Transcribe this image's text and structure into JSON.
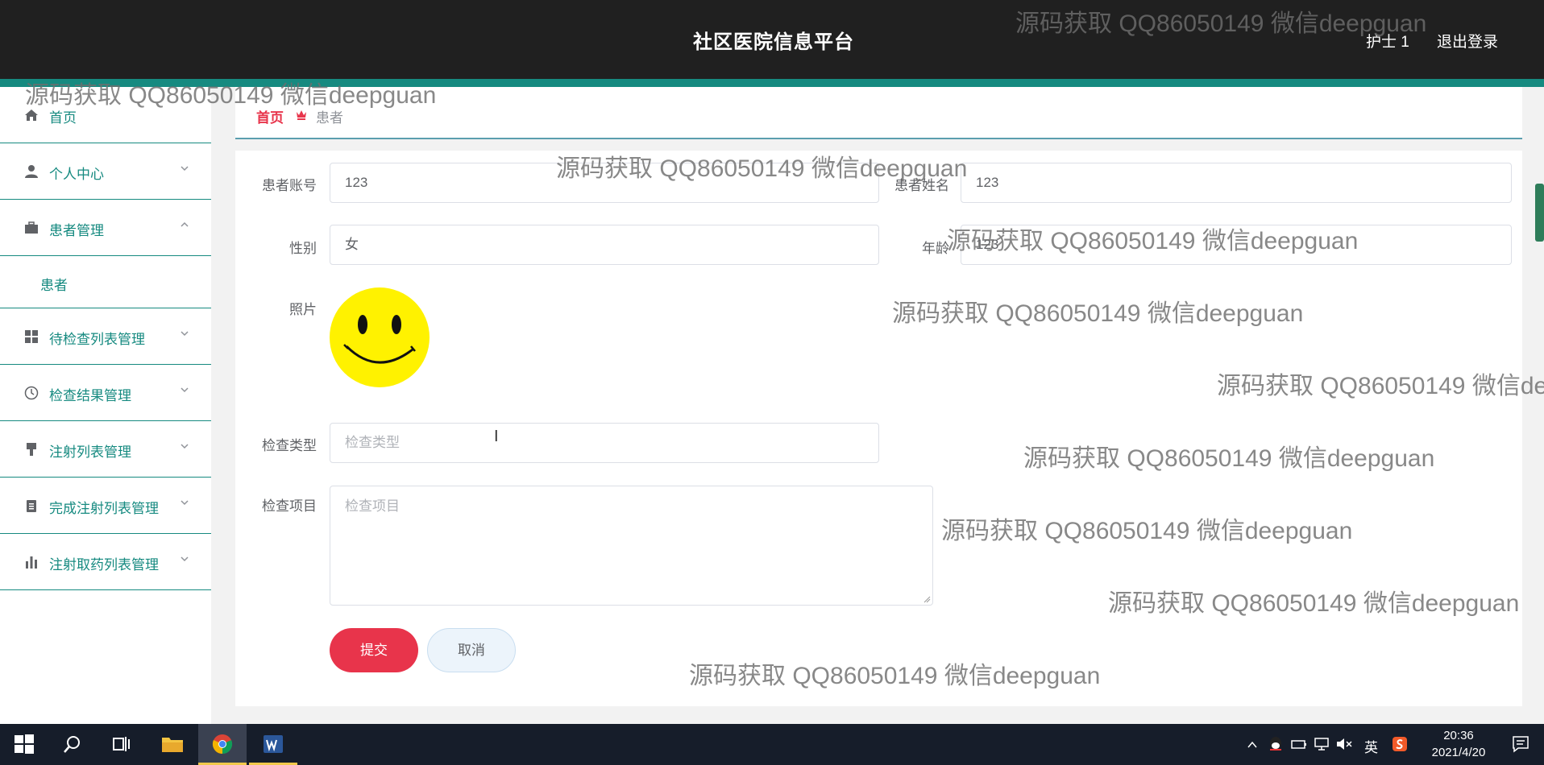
{
  "header": {
    "title": "社区医院信息平台",
    "user_role": "护士 1",
    "logout_label": "退出登录"
  },
  "sidebar": {
    "items": [
      {
        "label": "首页",
        "icon": "home-icon"
      },
      {
        "label": "个人中心",
        "icon": "user-icon"
      },
      {
        "label": "患者管理",
        "icon": "briefcase-icon",
        "expanded": true,
        "children": [
          {
            "label": "患者"
          }
        ]
      },
      {
        "label": "待检查列表管理",
        "icon": "grid-icon"
      },
      {
        "label": "检查结果管理",
        "icon": "clock-icon"
      },
      {
        "label": "注射列表管理",
        "icon": "flag-icon"
      },
      {
        "label": "完成注射列表管理",
        "icon": "clipboard-icon"
      },
      {
        "label": "注射取药列表管理",
        "icon": "bar-chart-icon"
      }
    ]
  },
  "breadcrumb": {
    "home": "首页",
    "current": "患者"
  },
  "form": {
    "account_label": "患者账号",
    "account_value": "123",
    "name_label": "患者姓名",
    "name_value": "123",
    "gender_label": "性别",
    "gender_value": "女",
    "age_label": "年龄",
    "age_value": "123",
    "photo_label": "照片",
    "exam_type_label": "检查类型",
    "exam_type_placeholder": "检查类型",
    "exam_item_label": "检查项目",
    "exam_item_placeholder": "检查项目",
    "submit_label": "提交",
    "cancel_label": "取消"
  },
  "watermark_text": "源码获取 QQ86050149 微信deepguan",
  "taskbar": {
    "ime": "英",
    "time": "20:36",
    "date": "2021/4/20"
  },
  "colors": {
    "header_bg": "#202020",
    "accent_teal": "#168a80",
    "accent_red": "#e8344b"
  }
}
